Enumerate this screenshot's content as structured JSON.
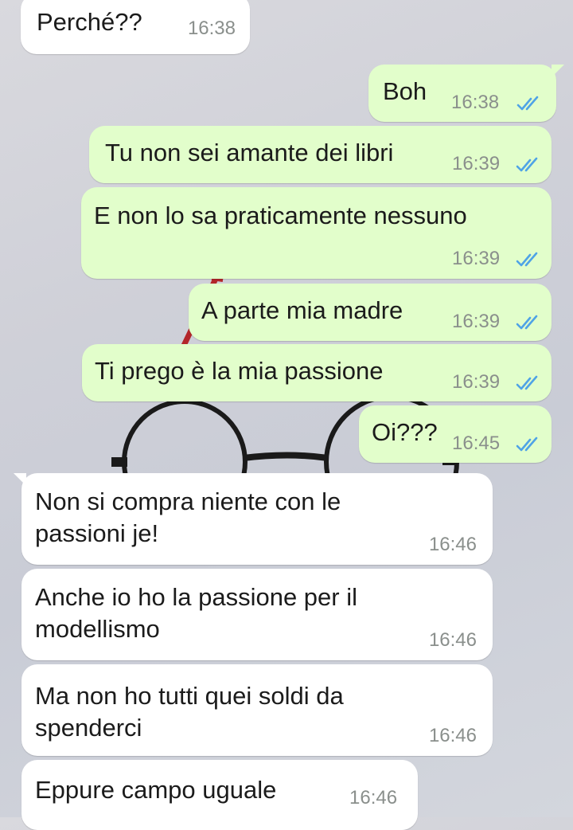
{
  "colors": {
    "incoming_bubble": "#ffffff",
    "outgoing_bubble": "#e2fecb",
    "read_ticks": "#4fa3e6",
    "timestamp": "#8a8f8c"
  },
  "messages": [
    {
      "direction": "incoming",
      "text": "Perché??",
      "time": "16:38"
    },
    {
      "direction": "outgoing",
      "text": "Boh",
      "time": "16:38",
      "status": "read"
    },
    {
      "direction": "outgoing",
      "text": "Tu non sei amante dei libri",
      "time": "16:39",
      "status": "read"
    },
    {
      "direction": "outgoing",
      "text": "E non lo sa praticamente nessuno",
      "time": "16:39",
      "status": "read"
    },
    {
      "direction": "outgoing",
      "text": "A parte mia madre",
      "time": "16:39",
      "status": "read"
    },
    {
      "direction": "outgoing",
      "text": "Ti prego è la mia passione",
      "time": "16:39",
      "status": "read"
    },
    {
      "direction": "outgoing",
      "text": "Oi???",
      "time": "16:45",
      "status": "read"
    },
    {
      "direction": "incoming",
      "text": "Non si compra niente con le\npassioni je!",
      "time": "16:46"
    },
    {
      "direction": "incoming",
      "text": "Anche io ho la passione per il\nmodellismo",
      "time": "16:46"
    },
    {
      "direction": "incoming",
      "text": "Ma non ho tutti quei soldi da\nspenderci",
      "time": "16:46"
    },
    {
      "direction": "incoming",
      "text": "Eppure campo uguale",
      "time": "16:46"
    }
  ]
}
